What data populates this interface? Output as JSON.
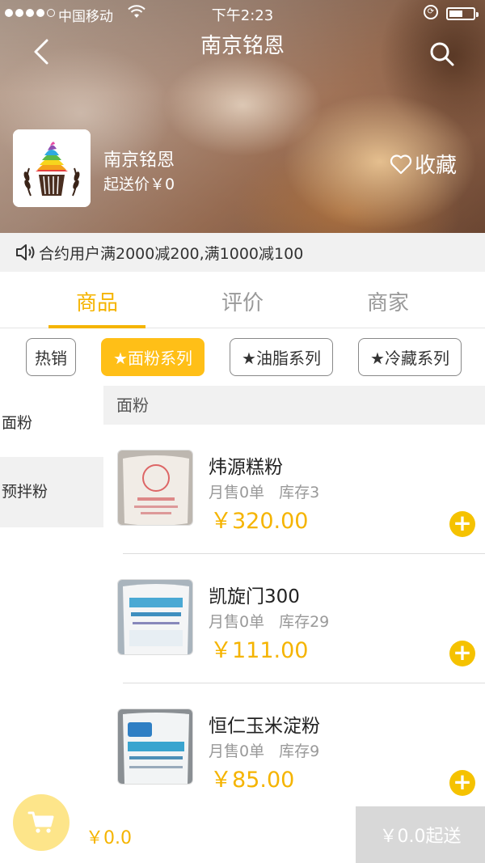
{
  "status_bar": {
    "carrier": "中国移动",
    "time": "下午2:23"
  },
  "nav": {
    "title": "南京铭恩"
  },
  "shop": {
    "name": "南京铭恩",
    "min_order": "起送价￥0",
    "favorite_label": "收藏"
  },
  "notice": {
    "text": "合约用户满2000减200,满1000减100"
  },
  "tabs": [
    {
      "label": "商品",
      "active": true
    },
    {
      "label": "评价",
      "active": false
    },
    {
      "label": "商家",
      "active": false
    }
  ],
  "filters": [
    {
      "label": "热销",
      "active": false
    },
    {
      "label": "★面粉系列",
      "active": true
    },
    {
      "label": "★油脂系列",
      "active": false
    },
    {
      "label": "★冷藏系列",
      "active": false
    }
  ],
  "categories": [
    {
      "label": "面粉",
      "selected": false
    },
    {
      "label": "预拌粉",
      "selected": true
    }
  ],
  "section": {
    "title": "面粉"
  },
  "products": [
    {
      "name": "炜源糕粉",
      "monthly_sales": "月售0单",
      "stock": "库存3",
      "price": "￥320.00"
    },
    {
      "name": "凯旋门300",
      "monthly_sales": "月售0单",
      "stock": "库存29",
      "price": "￥111.00"
    },
    {
      "name": "恒仁玉米淀粉",
      "monthly_sales": "月售0单",
      "stock": "库存9",
      "price": "￥85.00"
    }
  ],
  "cart": {
    "total": "￥0.0",
    "checkout_label": "￥0.0起送"
  },
  "colors": {
    "accent": "#f5b400",
    "chip_active": "#ffbf17",
    "cart_bg": "#fde58a",
    "checkout_disabled": "#d8d8d8"
  }
}
